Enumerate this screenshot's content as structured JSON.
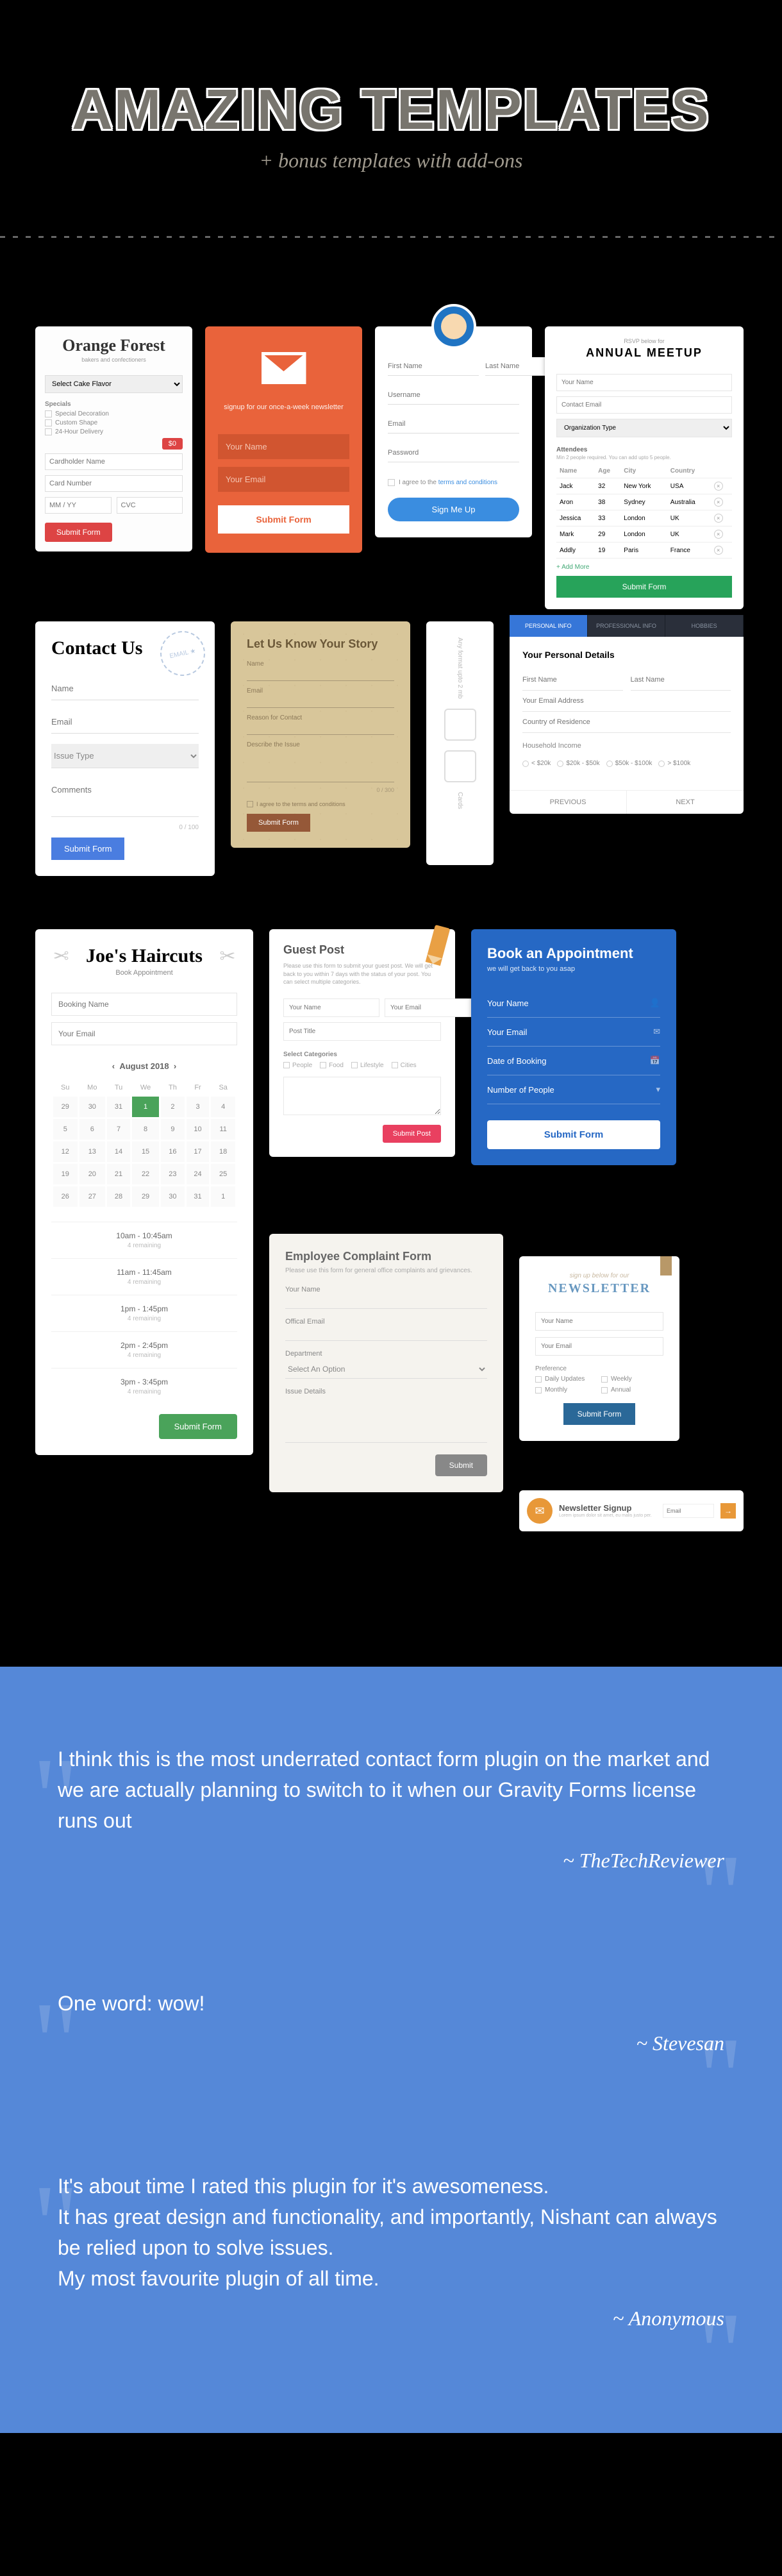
{
  "header": {
    "title": "AMAZING TEMPLATES",
    "sub": "+ bonus templates with add-ons"
  },
  "orange": {
    "title": "Orange Forest",
    "tag": "bakers and confectioners",
    "flavor": "Select Cake Flavor",
    "specials_lbl": "Specials",
    "opts": [
      "Special Decoration",
      "Custom Shape",
      "24-Hour Delivery"
    ],
    "price": "$0",
    "cardholder": "Cardholder Name",
    "cardnum": "Card Number",
    "exp": "MM / YY",
    "cvc": "CVC",
    "submit": "Submit Form"
  },
  "env": {
    "tag": "signup for our once-a-week newsletter",
    "name": "Your Name",
    "email": "Your Email",
    "submit": "Submit Form"
  },
  "signup": {
    "fn": "First Name",
    "ln": "Last Name",
    "user": "Username",
    "email": "Email",
    "pass": "Password",
    "agree_pre": "I agree to the ",
    "agree_link": "terms and conditions",
    "submit": "Sign Me Up"
  },
  "rsvp": {
    "pre": "RSVP below for",
    "title": "ANNUAL MEETUP",
    "name": "Your Name",
    "email": "Contact Email",
    "org": "Organization Type",
    "att_lbl": "Attendees",
    "att_note": "Min 2 people required. You can add upto 5 people.",
    "th": [
      "Name",
      "Age",
      "City",
      "Country"
    ],
    "rows": [
      [
        "Jack",
        "32",
        "New York",
        "USA"
      ],
      [
        "Aron",
        "38",
        "Sydney",
        "Australia"
      ],
      [
        "Jessica",
        "33",
        "London",
        "UK"
      ],
      [
        "Mark",
        "29",
        "London",
        "UK"
      ],
      [
        "Addly",
        "19",
        "Paris",
        "France"
      ]
    ],
    "addmore": "+ Add More",
    "submit": "Submit Form"
  },
  "contact": {
    "stamp": "EMAIL ★",
    "title": "Contact Us",
    "name": "Name",
    "email": "Email",
    "type": "Issue Type",
    "comments": "Comments",
    "count": "0 / 100",
    "submit": "Submit Form"
  },
  "story": {
    "title": "Let Us Know Your Story",
    "name": "Name",
    "email": "Email",
    "reason": "Reason for Contact",
    "describe": "Describe the Issue",
    "count": "0 / 300",
    "agree": "I agree to the terms and conditions",
    "submit": "Submit Form"
  },
  "upload": {
    "t1": "Any format upto 2 mb",
    "t2": "Cards"
  },
  "wizard": {
    "tabs": [
      "PERSONAL INFO",
      "PROFESSIONAL INFO",
      "HOBBIES"
    ],
    "title": "Your Personal Details",
    "fn": "First Name",
    "ln": "Last Name",
    "email": "Your Email Address",
    "country": "Country of Residence",
    "income_lbl": "Household Income",
    "income": [
      "< $20k",
      "$20k - $50k",
      "$50k - $100k",
      "> $100k"
    ],
    "prev": "PREVIOUS",
    "next": "NEXT"
  },
  "hair": {
    "title": "Joe's Haircuts",
    "sub": "Book Appointment",
    "name": "Booking Name",
    "email": "Your Email",
    "month": "August  2018",
    "days": [
      "Su",
      "Mo",
      "Tu",
      "We",
      "Th",
      "Fr",
      "Sa"
    ],
    "grid": [
      [
        "29",
        "30",
        "31",
        "1",
        "2",
        "3",
        "4"
      ],
      [
        "5",
        "6",
        "7",
        "8",
        "9",
        "10",
        "11"
      ],
      [
        "12",
        "13",
        "14",
        "15",
        "16",
        "17",
        "18"
      ],
      [
        "19",
        "20",
        "21",
        "22",
        "23",
        "24",
        "25"
      ],
      [
        "26",
        "27",
        "28",
        "29",
        "30",
        "31",
        "1"
      ]
    ],
    "sel": "1",
    "slots": [
      [
        "10am - 10:45am",
        "4 remaining"
      ],
      [
        "11am - 11:45am",
        "4 remaining"
      ],
      [
        "1pm - 1:45pm",
        "4 remaining"
      ],
      [
        "2pm - 2:45pm",
        "4 remaining"
      ],
      [
        "3pm - 3:45pm",
        "4 remaining"
      ]
    ],
    "submit": "Submit Form"
  },
  "guest": {
    "title": "Guest Post",
    "desc": "Please use this form to submit your guest post. We will get back to you within 7 days with the status of your post. You can select multiple categories.",
    "name": "Your Name",
    "email": "Your Email",
    "ptitle": "Post Title",
    "cat_lbl": "Select Categories",
    "cats": [
      "People",
      "Food",
      "Lifestyle",
      "Cities"
    ],
    "submit": "Submit Post"
  },
  "book": {
    "title": "Book an Appointment",
    "sub": "we will get back to you asap",
    "name": "Your Name",
    "email": "Your Email",
    "date": "Date of Booking",
    "people": "Number of People",
    "submit": "Submit Form"
  },
  "emp": {
    "title": "Employee Complaint Form",
    "desc": "Please use this form for general office complaints and grievances.",
    "name": "Your Name",
    "email": "Offical Email",
    "dept_lbl": "Department",
    "dept": "Select An Option",
    "issue": "Issue Details",
    "submit": "Submit"
  },
  "news": {
    "pre": "sign up below for our",
    "title": "NEWSLETTER",
    "name": "Your Name",
    "email": "Your Email",
    "pref_lbl": "Preference",
    "prefs": [
      "Daily Updates",
      "Weekly",
      "Monthly",
      "Annual"
    ],
    "submit": "Submit Form"
  },
  "bar": {
    "title": "Newsletter Signup",
    "desc": "Lorem ipsum dolor sit amet, eu malis justo per.",
    "ph": "Email",
    "go": "→"
  },
  "testimonials": [
    {
      "text": "I think this is the most underrated contact form plugin on the market and we are actually planning to switch to it when our Gravity Forms license runs out",
      "auth": "~ TheTechReviewer"
    },
    {
      "text": "One word: wow!",
      "auth": "~ Stevesan"
    },
    {
      "text": "It's about time I rated this plugin for it's awesomeness.\nIt has great design and functionality, and importantly, Nishant can always be relied upon to solve issues.\nMy most favourite plugin of all time.",
      "auth": "~ Anonymous"
    }
  ]
}
